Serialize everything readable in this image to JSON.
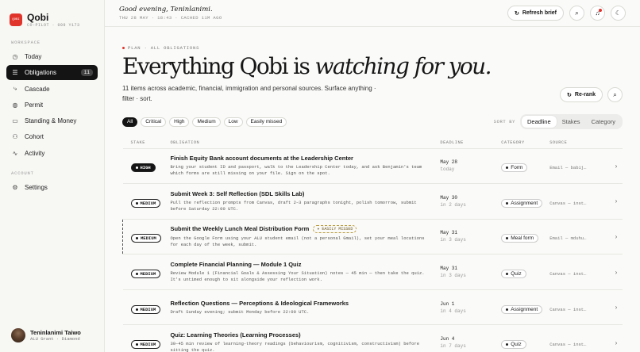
{
  "brand": {
    "name": "Qobi",
    "sub": "CO-PILOT · 009 Y173",
    "logo_text": "QOBI"
  },
  "sidebar": {
    "section_workspace": "WORKSPACE",
    "items": [
      {
        "label": "Today",
        "icon": "clock-icon"
      },
      {
        "label": "Obligations",
        "icon": "list-icon",
        "count": "11"
      },
      {
        "label": "Cascade",
        "icon": "cascade-icon"
      },
      {
        "label": "Permit",
        "icon": "globe-icon"
      },
      {
        "label": "Standing & Money",
        "icon": "wallet-icon"
      },
      {
        "label": "Cohort",
        "icon": "people-icon"
      },
      {
        "label": "Activity",
        "icon": "activity-icon"
      }
    ],
    "section_account": "ACCOUNT",
    "settings": "Settings",
    "user": {
      "name": "Teninlanimi Taiwo",
      "sub": "ALU Grant · Diamond"
    }
  },
  "topbar": {
    "greeting": "Good evening, Teninlanimi.",
    "datetime": "THU 28 MAY · 18:43 · CACHED 11M AGO",
    "refresh_label": "Refresh brief"
  },
  "header": {
    "eyebrow": "PLAN · ALL OBLIGATIONS",
    "title_plain": "Everything Qobi is ",
    "title_italic": "watching for you.",
    "description": "11 items across academic, financial, immigration and personal sources. Surface anything · filter · sort.",
    "rerank_label": "Re-rank"
  },
  "filters": {
    "chips": [
      "All",
      "Critical",
      "High",
      "Medium",
      "Low",
      "Easily missed"
    ],
    "active": "All",
    "sort_label": "SORT BY",
    "sort_options": [
      "Deadline",
      "Stakes",
      "Category"
    ],
    "sort_active": "Deadline"
  },
  "table": {
    "headers": [
      "STAKE",
      "OBLIGATION",
      "DEADLINE",
      "CATEGORY",
      "SOURCE"
    ],
    "rows": [
      {
        "stake": "HIGH",
        "title": "Finish Equity Bank account documents at the Leadership Center",
        "desc": "Bring your student ID and passport, walk to the Leadership Center today, and ask Benjamin's team which forms are still missing on your file. Sign on the spot.",
        "deadline": "May 28",
        "rel": "today",
        "category": "Form",
        "source": "Email — babij…"
      },
      {
        "stake": "MEDIUM",
        "title": "Submit Week 3: Self Reflection (SDL Skills Lab)",
        "desc": "Pull the reflection prompts from Canvas, draft 2–3 paragraphs tonight, polish tomorrow, submit before Saturday 22:00 UTC.",
        "deadline": "May 30",
        "rel": "in 2 days",
        "category": "Assignment",
        "source": "Canvas — inst…"
      },
      {
        "stake": "MEDIUM",
        "title": "Submit the Weekly Lunch Meal Distribution Form",
        "badge": "EASILY MISSED",
        "desc": "Open the Google Form using your ALU student email (not a personal Gmail), set your meal locations for each day of the week, submit.",
        "deadline": "May 31",
        "rel": "in 3 days",
        "category": "Meal form",
        "source": "Email — mduhu…"
      },
      {
        "stake": "MEDIUM",
        "title": "Complete Financial Planning — Module 1 Quiz",
        "desc": "Review Module 1 (Financial Goals & Assessing Your Situation) notes — 45 min — then take the quiz. It's untimed enough to sit alongside your reflection work.",
        "deadline": "May 31",
        "rel": "in 3 days",
        "category": "Quiz",
        "source": "Canvas — inst…"
      },
      {
        "stake": "MEDIUM",
        "title": "Reflection Questions — Perceptions & Ideological Frameworks",
        "desc": "Draft Sunday evening; submit Monday before 22:00 UTC.",
        "deadline": "Jun 1",
        "rel": "in 4 days",
        "category": "Assignment",
        "source": "Canvas — inst…"
      },
      {
        "stake": "MEDIUM",
        "title": "Quiz: Learning Theories (Learning Processes)",
        "desc": "30–45 min review of learning-theory readings (behaviourism, cognitivism, constructivism) before sitting the quiz.",
        "deadline": "Jun 4",
        "rel": "in 7 days",
        "category": "Quiz",
        "source": "Canvas — inst…"
      }
    ]
  }
}
